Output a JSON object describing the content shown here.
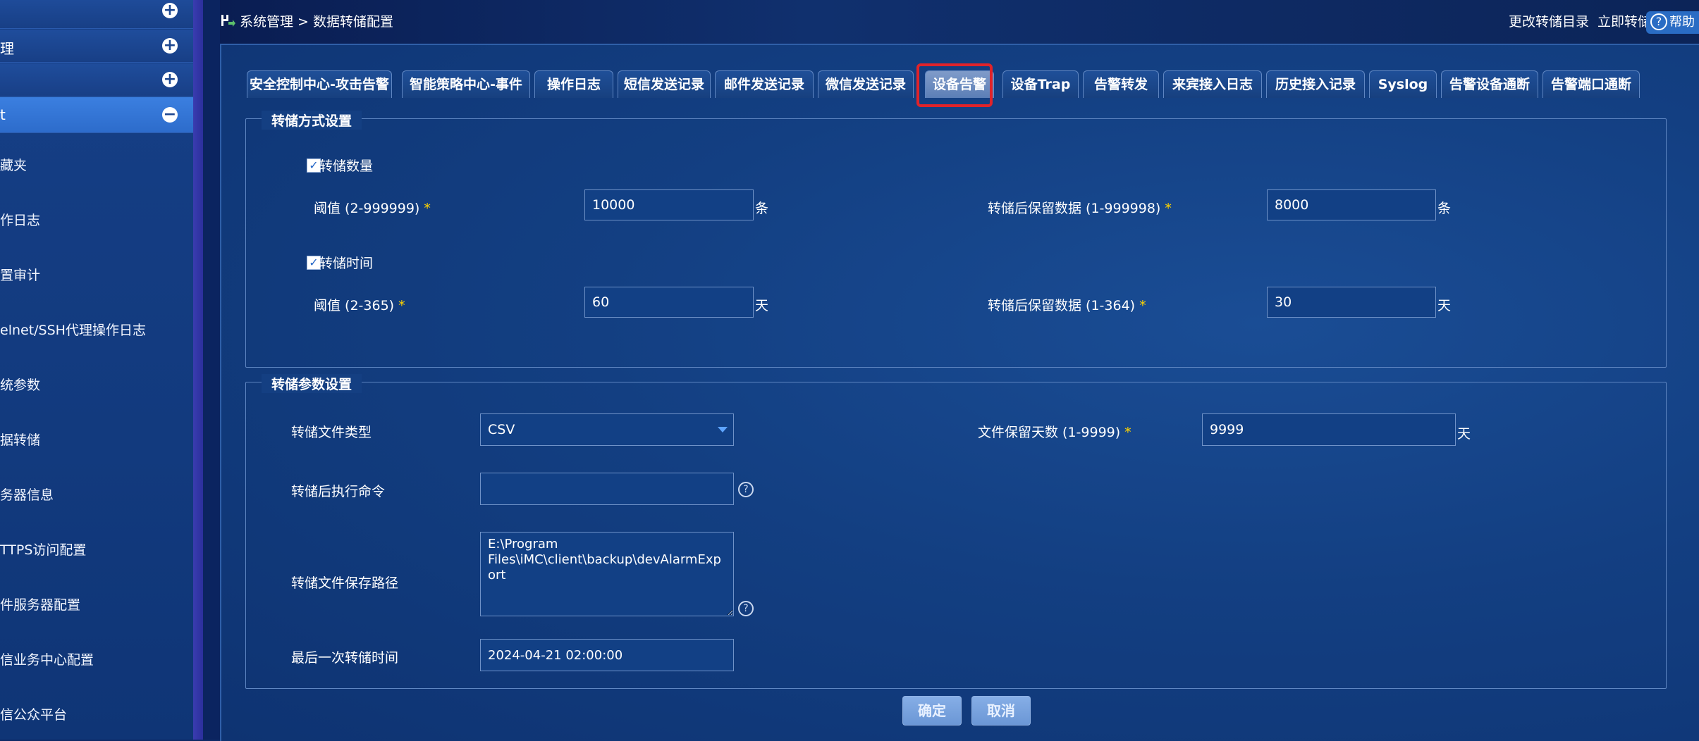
{
  "sidebar": {
    "headers": [
      {
        "label": "",
        "toggle": "+"
      },
      {
        "label": "理",
        "toggle": "+"
      },
      {
        "label": "",
        "toggle": "+"
      },
      {
        "label": "t",
        "toggle": "−"
      }
    ],
    "items": [
      {
        "label": "藏夹"
      },
      {
        "label": "作日志"
      },
      {
        "label": "置审计"
      },
      {
        "label": "elnet/SSH代理操作日志"
      },
      {
        "label": "统参数"
      },
      {
        "label": "据转储"
      },
      {
        "label": "务器信息"
      },
      {
        "label": "TTPS访问配置"
      },
      {
        "label": "件服务器配置"
      },
      {
        "label": "信业务中心配置"
      },
      {
        "label": "信公众平台"
      }
    ]
  },
  "topbar": {
    "breadcrumb": "系统管理 > 数据转储配置",
    "change_dir": "更改转储目录",
    "dump_now": "立即转储",
    "help": "帮助"
  },
  "tabs": [
    {
      "label": "安全控制中心-攻击告警"
    },
    {
      "label": "智能策略中心-事件"
    },
    {
      "label": "操作日志"
    },
    {
      "label": "短信发送记录"
    },
    {
      "label": "邮件发送记录"
    },
    {
      "label": "微信发送记录"
    },
    {
      "label": "设备告警",
      "active": true
    },
    {
      "label": "设备Trap"
    },
    {
      "label": "告警转发"
    },
    {
      "label": "来宾接入日志"
    },
    {
      "label": "历史接入记录"
    },
    {
      "label": "Syslog"
    },
    {
      "label": "告警设备通断"
    },
    {
      "label": "告警端口通断"
    }
  ],
  "dump_mode": {
    "title": "转储方式设置",
    "by_count": {
      "checkbox_label": "转储数量",
      "checked": true,
      "threshold_label": "阈值 (2-999999)",
      "threshold_value": "10000",
      "threshold_unit": "条",
      "keep_label": "转储后保留数据 (1-999998)",
      "keep_value": "8000",
      "keep_unit": "条"
    },
    "by_time": {
      "checkbox_label": "转储时间",
      "checked": true,
      "threshold_label": "阈值 (2-365)",
      "threshold_value": "60",
      "threshold_unit": "天",
      "keep_label": "转储后保留数据 (1-364)",
      "keep_value": "30",
      "keep_unit": "天"
    },
    "required_mark": "*"
  },
  "dump_params": {
    "title": "转储参数设置",
    "file_type_label": "转储文件类型",
    "file_type_value": "CSV",
    "retention_label": "文件保留天数 (1-9999)",
    "retention_value": "9999",
    "retention_unit": "天",
    "command_label": "转储后执行命令",
    "command_value": "",
    "path_label": "转储文件保存路径",
    "path_value": "E:\\Program Files\\iMC\\client\\backup\\devAlarmExport",
    "last_time_label": "最后一次转储时间",
    "last_time_value": "2024-04-21 02:00:00"
  },
  "buttons": {
    "ok": "确定",
    "cancel": "取消"
  },
  "colors": {
    "highlight": "#e0232a",
    "required": "#ffd400",
    "accent": "#2d6ccb"
  }
}
